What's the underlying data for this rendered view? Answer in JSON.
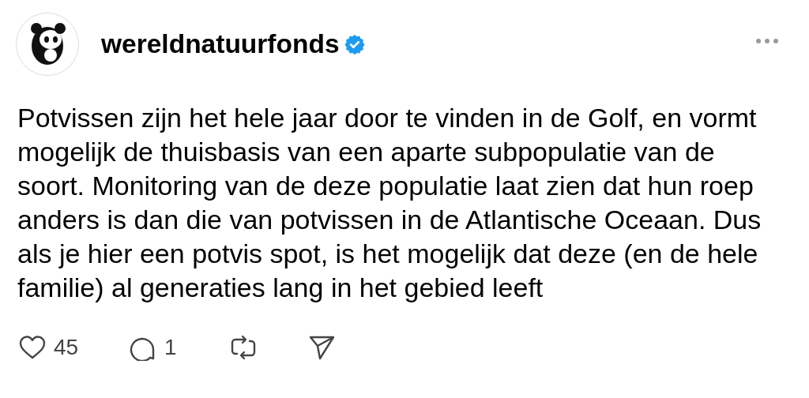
{
  "post": {
    "username": "wereldnatuurfonds",
    "verified": true,
    "body_lines": [
      "Potvissen zijn het hele jaar door te vinden in de Golf, en vormt",
      "mogelijk de thuisbasis van een aparte subpopulatie van de",
      "soort. Monitoring van de deze populatie laat zien dat hun roep",
      "anders is dan die van potvissen in de Atlantische Oceaan. Dus",
      "als je hier een potvis spot, is het mogelijk dat deze (en de hele",
      "familie) al generaties lang in het gebied leeft"
    ],
    "actions": [
      {
        "kind": "like",
        "count": "45"
      },
      {
        "kind": "reply",
        "count": "1"
      },
      {
        "kind": "repost"
      },
      {
        "kind": "share"
      }
    ]
  }
}
